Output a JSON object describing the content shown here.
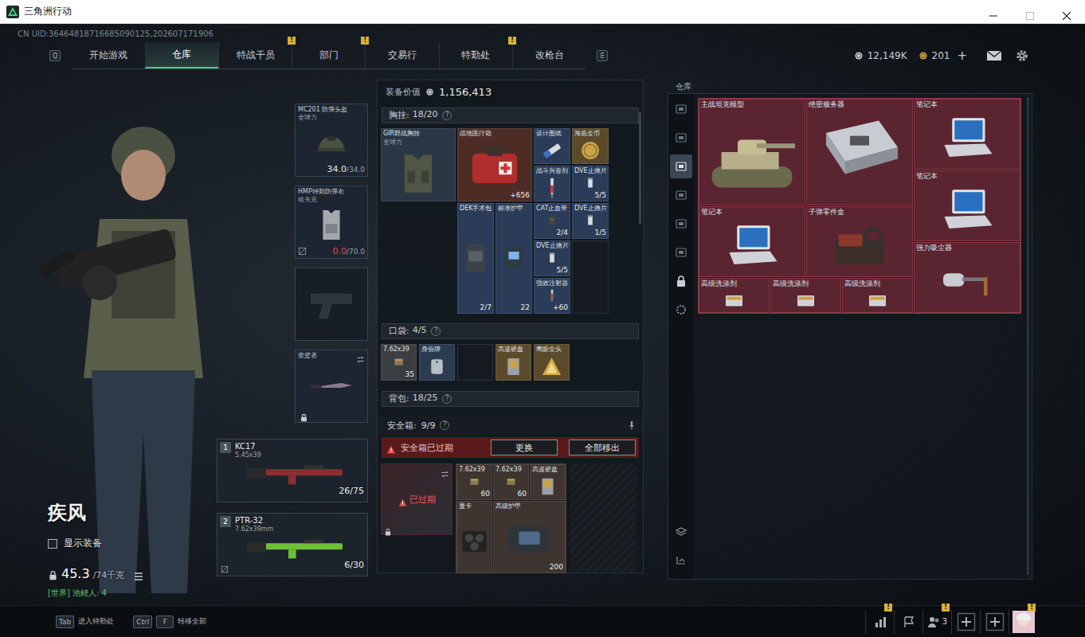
{
  "window": {
    "title": "三角洲行动"
  },
  "uid": "CN UID:36464818716685090125,202607171906",
  "nav": {
    "left_key": "Q",
    "right_key": "E",
    "tabs": [
      {
        "label": "开始游戏",
        "selected": false,
        "badge": ""
      },
      {
        "label": "仓库",
        "selected": true,
        "badge": ""
      },
      {
        "label": "特战干员",
        "selected": false,
        "badge": "!"
      },
      {
        "label": "部门",
        "selected": false,
        "badge": "!"
      },
      {
        "label": "交易行",
        "selected": false,
        "badge": ""
      },
      {
        "label": "特勤处",
        "selected": false,
        "badge": "!"
      },
      {
        "label": "改枪台",
        "selected": false,
        "badge": ""
      }
    ]
  },
  "currencies": [
    {
      "amount": "12,149K",
      "color": "#c9ced6"
    },
    {
      "amount": "201",
      "color": "#d9a441"
    }
  ],
  "currency_add": "+",
  "character": {
    "name": "疾风",
    "show_gear": {
      "label": "显示装备",
      "checked": false
    },
    "weight": "45.3",
    "weight_max": "/74千克",
    "chat": "[世界] 池鲤人: 4"
  },
  "slots": [
    {
      "kind": "helmet",
      "name": "MC201 防弹头盔",
      "sub": "全球力",
      "reading": "34.0",
      "max": "/34.0",
      "depleted": false,
      "uninsured": false
    },
    {
      "kind": "armor",
      "name": "HMP特勤防弹衣",
      "sub": "哈夫克",
      "reading": "0.0",
      "max": "/70.0",
      "depleted": true,
      "uninsured": true
    },
    {
      "kind": "pistol",
      "empty": true
    },
    {
      "kind": "melee",
      "name": "坚壁者",
      "locked": true
    }
  ],
  "weapons": [
    {
      "index": "1",
      "name": "KC17",
      "caliber": "5.45x39",
      "ammo": "26/75",
      "color": "#8a2f2f",
      "uninsured": false
    },
    {
      "index": "2",
      "name": "PTR-32",
      "caliber": "7.62x39mm",
      "ammo": "6/30",
      "color": "#6fbf3a",
      "uninsured": true
    }
  ],
  "loadout": {
    "value_label": "装备价值",
    "value": "1,156,413",
    "chest": {
      "label": "胸挂:",
      "count": "18/20",
      "help": "?",
      "items": [
        {
          "name": "GIR野战胸挂",
          "sub": "全球力",
          "count": "",
          "color": "#2b3645"
        },
        {
          "name": "战地医疗箱",
          "sub": "",
          "count": "+656",
          "color": "#4e2c26"
        },
        {
          "name": "设计图纸",
          "sub": "",
          "count": "",
          "color": "#2a3c58"
        },
        {
          "name": "海底金币",
          "sub": "",
          "count": "",
          "color": "#5a4a2a"
        },
        {
          "name": "战斗兴奋剂",
          "sub": "",
          "count": "",
          "color": "#2a3c58"
        },
        {
          "name": "DVE止痛片",
          "sub": "",
          "count": "5/5",
          "color": "#2a3c58"
        },
        {
          "name": "DEK手术包",
          "sub": "",
          "count": "2/7",
          "color": "#2a3c58"
        },
        {
          "name": "标准护甲",
          "sub": "",
          "count": "22",
          "color": "#2a3c58"
        },
        {
          "name": "CAT止血带",
          "sub": "",
          "count": "2/4",
          "color": "#2a3c58"
        },
        {
          "name": "DVE止痛片",
          "sub": "",
          "count": "1/5",
          "color": "#2a3c58"
        },
        {
          "name": "DVE止痛片",
          "sub": "",
          "count": "5/5",
          "color": "#2a3c58"
        },
        {
          "name": "强效注射器",
          "sub": "",
          "count": "+60",
          "color": "#2a3c58"
        }
      ]
    },
    "pockets": {
      "label": "口袋:",
      "count": "4/5",
      "help": "?",
      "items": [
        {
          "name": "7.62x39",
          "count": "35",
          "color": "#3a3d42",
          "empty": false
        },
        {
          "name": "身份牌",
          "count": "",
          "color": "#2c3c50",
          "empty": false
        },
        {
          "name": "",
          "count": "",
          "color": "#141a20",
          "empty": true
        },
        {
          "name": "高速硬盘",
          "count": "",
          "color": "#5b4a2b",
          "empty": false
        },
        {
          "name": "鹰眼金头",
          "count": "",
          "color": "#5b4a2b",
          "empty": false
        }
      ]
    },
    "backpack": {
      "label": "背包:",
      "count": "18/25",
      "help": "?"
    },
    "safe": {
      "label": "安全箱:",
      "count": "9/9",
      "help": "?",
      "warning": "安全箱已过期",
      "buttons": [
        {
          "label": "更换"
        },
        {
          "label": "全部移出"
        }
      ],
      "case_status": "已过期",
      "items": [
        {
          "name": "7.62x39",
          "count": "60",
          "color": "#3e3530"
        },
        {
          "name": "7.62x39",
          "count": "60",
          "color": "#3e3530"
        },
        {
          "name": "高速硬盘",
          "count": "",
          "color": "#3e3530"
        },
        {
          "name": "显卡",
          "count": "",
          "color": "#3e3530"
        },
        {
          "name": "高级护甲",
          "count": "200",
          "color": "#3e3530"
        }
      ]
    }
  },
  "stash": {
    "title": "仓库",
    "side_tabs": [
      {
        "selected": false
      },
      {
        "selected": false
      },
      {
        "selected": true
      },
      {
        "selected": false
      },
      {
        "selected": false
      },
      {
        "selected": false
      },
      {
        "selected": false
      },
      {
        "selected": false
      },
      {
        "selected": false
      },
      {
        "selected": false
      }
    ],
    "items": [
      {
        "name": "主战坦克模型"
      },
      {
        "name": "绝密服务器"
      },
      {
        "name": "笔记本"
      },
      {
        "name": "笔记本"
      },
      {
        "name": "笔记本"
      },
      {
        "name": "子弹零件盒"
      },
      {
        "name": "强力吸尘器"
      },
      {
        "name": "高级洗涤剂"
      },
      {
        "name": "高级洗涤剂"
      },
      {
        "name": "高级洗涤剂"
      }
    ]
  },
  "bottom": {
    "hints": [
      {
        "keys": [
          "Tab"
        ],
        "label": "进入特勤处"
      },
      {
        "keys": [
          "Ctrl",
          "F"
        ],
        "label": "转移全部"
      }
    ],
    "icons": [
      {
        "kind": "stats",
        "badge": "!",
        "count": ""
      },
      {
        "kind": "flag",
        "badge": "",
        "count": ""
      },
      {
        "kind": "friends",
        "badge": "!",
        "count": "3"
      },
      {
        "kind": "add",
        "badge": "",
        "count": ""
      },
      {
        "kind": "add",
        "badge": "",
        "count": ""
      },
      {
        "kind": "avatar",
        "badge": "!",
        "count": ""
      }
    ]
  }
}
